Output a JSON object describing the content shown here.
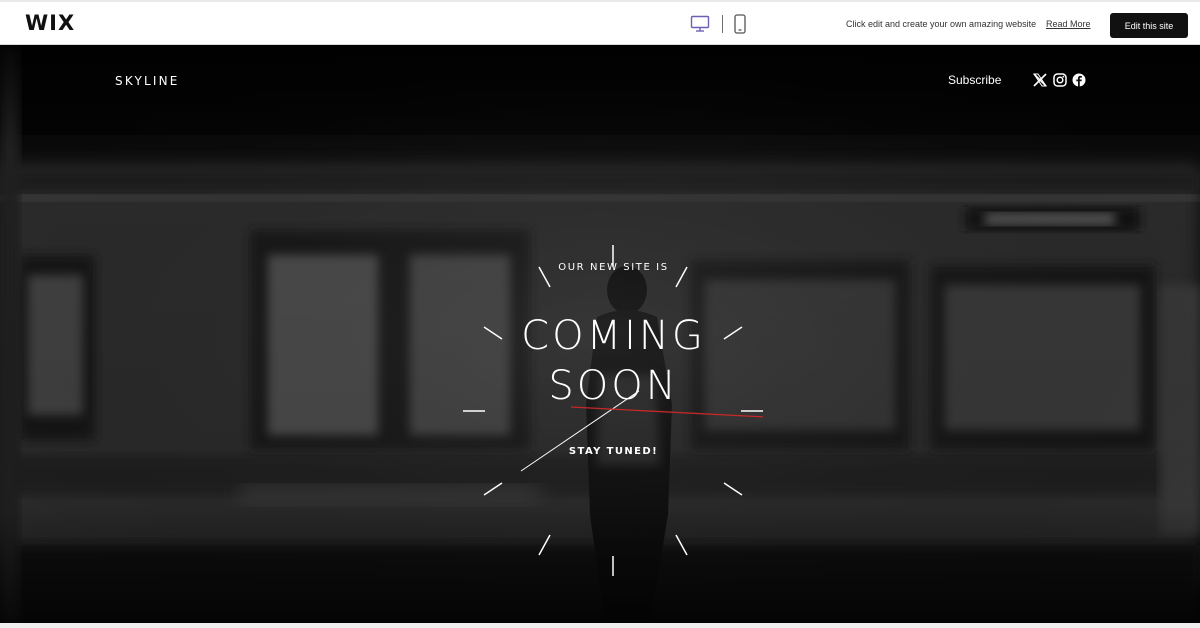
{
  "topbar": {
    "logo": "WIX",
    "desktop_icon": "desktop-monitor-icon",
    "mobile_icon": "mobile-phone-icon",
    "promo_text": "Click edit and create your own amazing website",
    "read_more_label": "Read More",
    "edit_button_label": "Edit this site"
  },
  "site": {
    "logo": "SKYLINE",
    "subscribe_label": "Subscribe",
    "social_icons": [
      "x-icon",
      "instagram-icon",
      "facebook-icon"
    ],
    "hero": {
      "eyebrow": "OUR NEW SITE IS",
      "headline_line1": "COMING",
      "headline_line2": "SOON",
      "tagline": "STAY TUNED!"
    }
  },
  "colors": {
    "topbar_bg": "#ffffff",
    "edit_button_bg": "#111111",
    "hero_bg": "#0a0a0a",
    "hero_text": "#ffffff",
    "accent_line": "#c62828",
    "device_active": "#6f5fb0"
  }
}
